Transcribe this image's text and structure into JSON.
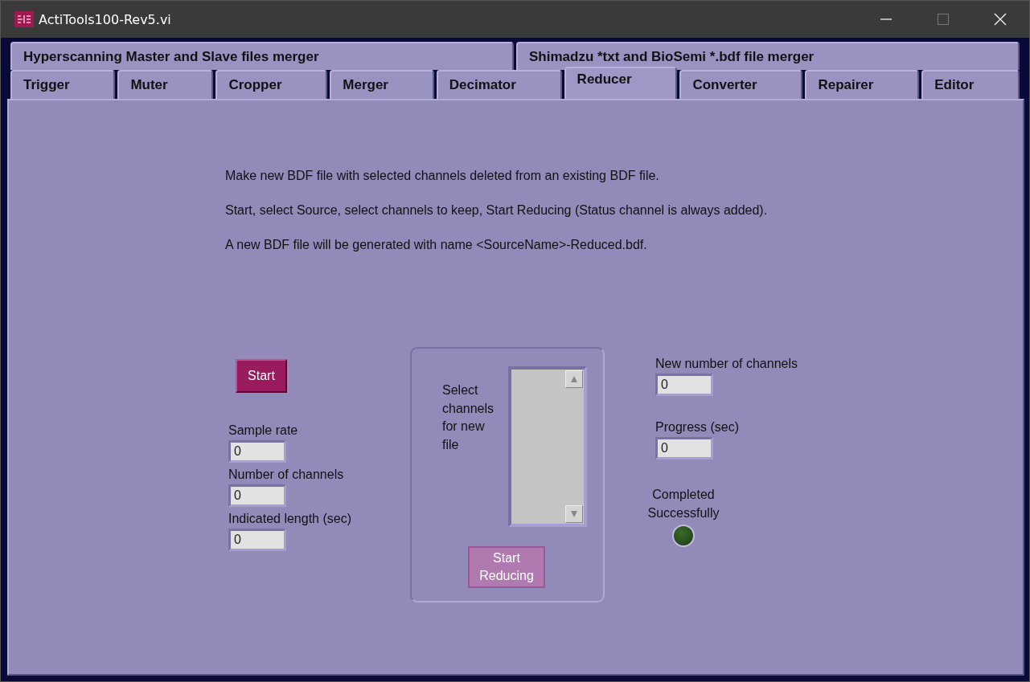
{
  "window": {
    "title": "ActiTools100-Rev5.vi"
  },
  "tabs_row1": [
    {
      "label": "Hyperscanning Master and Slave files merger",
      "selected": false
    },
    {
      "label": "Shimadzu *txt and BioSemi *.bdf file merger",
      "selected": false
    }
  ],
  "tabs_row2": [
    {
      "label": "Trigger",
      "selected": false
    },
    {
      "label": "Muter",
      "selected": false
    },
    {
      "label": "Cropper",
      "selected": false
    },
    {
      "label": "Merger",
      "selected": false
    },
    {
      "label": "Decimator",
      "selected": false
    },
    {
      "label": "Reducer",
      "selected": true
    },
    {
      "label": "Converter",
      "selected": false
    },
    {
      "label": "Repairer",
      "selected": false
    },
    {
      "label": "Editor",
      "selected": false
    }
  ],
  "instructions": [
    "Make new BDF file with selected channels deleted from an existing BDF file.",
    "Start, select Source, select channels to keep, Start Reducing (Status channel is always added).",
    "A new BDF file will be generated with name <SourceName>-Reduced.bdf."
  ],
  "start_button": {
    "label": "Start",
    "disabled": false
  },
  "left_fields": [
    {
      "label": "Sample rate",
      "value": "0"
    },
    {
      "label": "Number of channels",
      "value": "0"
    },
    {
      "label": "Indicated length (sec)",
      "value": "0"
    }
  ],
  "channel_select": {
    "label": "Select channels for new file",
    "reduce_button": {
      "label": "Start Reducing",
      "disabled": true
    }
  },
  "right_fields": [
    {
      "label": "New number of channels",
      "value": "0"
    },
    {
      "label": "Progress (sec)",
      "value": "0"
    }
  ],
  "completed": {
    "label": "Completed Successfully",
    "on": false
  }
}
